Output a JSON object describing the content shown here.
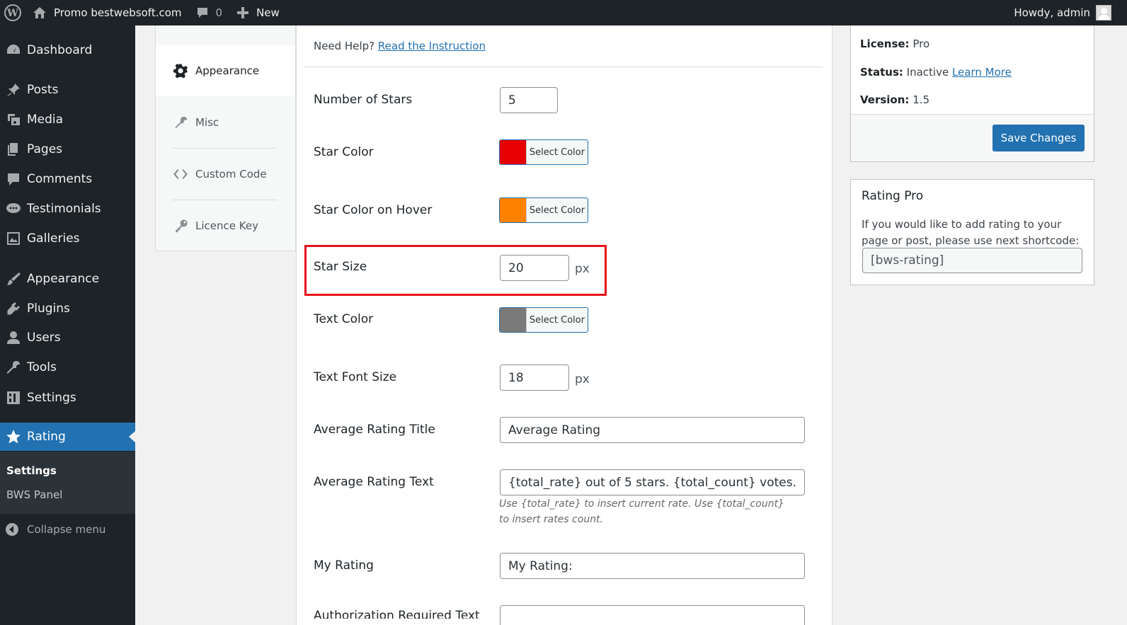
{
  "adminbar": {
    "site_name": "Promo bestwebsoft.com",
    "comments_count": "0",
    "new_label": "New",
    "greeting": "Howdy, admin"
  },
  "sidebar": {
    "items": [
      {
        "label": "Dashboard",
        "icon": "dashboard-icon"
      },
      {
        "label": "Posts",
        "icon": "pin-icon"
      },
      {
        "label": "Media",
        "icon": "media-icon"
      },
      {
        "label": "Pages",
        "icon": "pages-icon"
      },
      {
        "label": "Comments",
        "icon": "comment-icon"
      },
      {
        "label": "Testimonials",
        "icon": "testimonial-icon"
      },
      {
        "label": "Galleries",
        "icon": "gallery-icon"
      },
      {
        "label": "Appearance",
        "icon": "brush-icon"
      },
      {
        "label": "Plugins",
        "icon": "plugin-icon"
      },
      {
        "label": "Users",
        "icon": "user-icon"
      },
      {
        "label": "Tools",
        "icon": "wrench-icon"
      },
      {
        "label": "Settings",
        "icon": "settings-icon"
      },
      {
        "label": "Rating",
        "icon": "star-icon"
      }
    ],
    "submenu": [
      "Settings",
      "BWS Panel"
    ],
    "collapse_label": "Collapse menu"
  },
  "tabs": [
    {
      "label": "Appearance",
      "icon": "gear-icon",
      "active": true
    },
    {
      "label": "Misc",
      "icon": "wrench-icon",
      "active": false
    },
    {
      "label": "Custom Code",
      "icon": "code-icon",
      "active": false
    },
    {
      "label": "Licence Key",
      "icon": "key-icon",
      "active": false
    }
  ],
  "main": {
    "heading": "Appearance",
    "help_text": "Need Help?",
    "help_link": "Read the Instruction",
    "rows": {
      "number_of_stars": {
        "label": "Number of Stars",
        "value": "5"
      },
      "star_color": {
        "label": "Star Color",
        "button": "Select Color",
        "color": "#e60000"
      },
      "star_color_hover": {
        "label": "Star Color on Hover",
        "button": "Select Color",
        "color": "#ff8200"
      },
      "star_size": {
        "label": "Star Size",
        "value": "20",
        "unit": "px"
      },
      "text_color": {
        "label": "Text Color",
        "button": "Select Color",
        "color": "#7a7a7a"
      },
      "text_font_size": {
        "label": "Text Font Size",
        "value": "18",
        "unit": "px"
      },
      "average_rating_title": {
        "label": "Average Rating Title",
        "value": "Average Rating"
      },
      "average_rating_text": {
        "label": "Average Rating Text",
        "value": "{total_rate} out of 5 stars. {total_count} votes.",
        "description": "Use {total_rate} to insert current rate. Use {total_count} to insert rates count."
      },
      "my_rating": {
        "label": "My Rating",
        "value": "My Rating:"
      },
      "authorization_required": {
        "label": "Authorization Required Text"
      }
    }
  },
  "license_box": {
    "license_label": "License:",
    "license_value": "Pro",
    "status_label": "Status:",
    "status_value": "Inactive",
    "learn_more": "Learn More",
    "version_label": "Version:",
    "version_value": "1.5",
    "save_button": "Save Changes"
  },
  "rating_box": {
    "title": "Rating Pro",
    "text": "If you would like to add rating to your page or post, please use next shortcode:",
    "shortcode": "[bws-rating]"
  },
  "colors": {
    "admin_bar": "#1d2327",
    "accent": "#2271b1",
    "highlight": "#e8141d"
  }
}
